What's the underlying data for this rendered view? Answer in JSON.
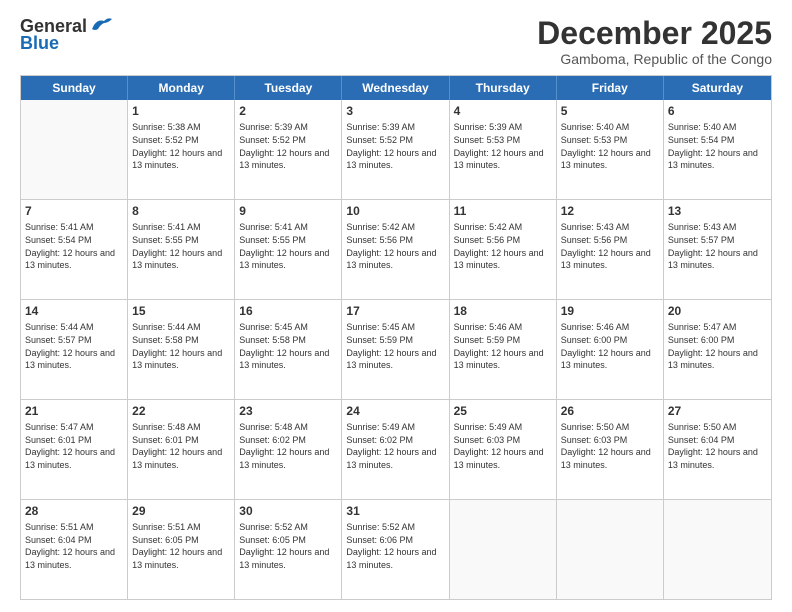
{
  "logo": {
    "general": "General",
    "blue": "Blue"
  },
  "title": "December 2025",
  "subtitle": "Gamboma, Republic of the Congo",
  "weekdays": [
    "Sunday",
    "Monday",
    "Tuesday",
    "Wednesday",
    "Thursday",
    "Friday",
    "Saturday"
  ],
  "weeks": [
    [
      {
        "day": "",
        "info": ""
      },
      {
        "day": "1",
        "info": "Sunrise: 5:38 AM\nSunset: 5:52 PM\nDaylight: 12 hours and 13 minutes."
      },
      {
        "day": "2",
        "info": "Sunrise: 5:39 AM\nSunset: 5:52 PM\nDaylight: 12 hours and 13 minutes."
      },
      {
        "day": "3",
        "info": "Sunrise: 5:39 AM\nSunset: 5:52 PM\nDaylight: 12 hours and 13 minutes."
      },
      {
        "day": "4",
        "info": "Sunrise: 5:39 AM\nSunset: 5:53 PM\nDaylight: 12 hours and 13 minutes."
      },
      {
        "day": "5",
        "info": "Sunrise: 5:40 AM\nSunset: 5:53 PM\nDaylight: 12 hours and 13 minutes."
      },
      {
        "day": "6",
        "info": "Sunrise: 5:40 AM\nSunset: 5:54 PM\nDaylight: 12 hours and 13 minutes."
      }
    ],
    [
      {
        "day": "7",
        "info": "Sunrise: 5:41 AM\nSunset: 5:54 PM\nDaylight: 12 hours and 13 minutes."
      },
      {
        "day": "8",
        "info": "Sunrise: 5:41 AM\nSunset: 5:55 PM\nDaylight: 12 hours and 13 minutes."
      },
      {
        "day": "9",
        "info": "Sunrise: 5:41 AM\nSunset: 5:55 PM\nDaylight: 12 hours and 13 minutes."
      },
      {
        "day": "10",
        "info": "Sunrise: 5:42 AM\nSunset: 5:56 PM\nDaylight: 12 hours and 13 minutes."
      },
      {
        "day": "11",
        "info": "Sunrise: 5:42 AM\nSunset: 5:56 PM\nDaylight: 12 hours and 13 minutes."
      },
      {
        "day": "12",
        "info": "Sunrise: 5:43 AM\nSunset: 5:56 PM\nDaylight: 12 hours and 13 minutes."
      },
      {
        "day": "13",
        "info": "Sunrise: 5:43 AM\nSunset: 5:57 PM\nDaylight: 12 hours and 13 minutes."
      }
    ],
    [
      {
        "day": "14",
        "info": "Sunrise: 5:44 AM\nSunset: 5:57 PM\nDaylight: 12 hours and 13 minutes."
      },
      {
        "day": "15",
        "info": "Sunrise: 5:44 AM\nSunset: 5:58 PM\nDaylight: 12 hours and 13 minutes."
      },
      {
        "day": "16",
        "info": "Sunrise: 5:45 AM\nSunset: 5:58 PM\nDaylight: 12 hours and 13 minutes."
      },
      {
        "day": "17",
        "info": "Sunrise: 5:45 AM\nSunset: 5:59 PM\nDaylight: 12 hours and 13 minutes."
      },
      {
        "day": "18",
        "info": "Sunrise: 5:46 AM\nSunset: 5:59 PM\nDaylight: 12 hours and 13 minutes."
      },
      {
        "day": "19",
        "info": "Sunrise: 5:46 AM\nSunset: 6:00 PM\nDaylight: 12 hours and 13 minutes."
      },
      {
        "day": "20",
        "info": "Sunrise: 5:47 AM\nSunset: 6:00 PM\nDaylight: 12 hours and 13 minutes."
      }
    ],
    [
      {
        "day": "21",
        "info": "Sunrise: 5:47 AM\nSunset: 6:01 PM\nDaylight: 12 hours and 13 minutes."
      },
      {
        "day": "22",
        "info": "Sunrise: 5:48 AM\nSunset: 6:01 PM\nDaylight: 12 hours and 13 minutes."
      },
      {
        "day": "23",
        "info": "Sunrise: 5:48 AM\nSunset: 6:02 PM\nDaylight: 12 hours and 13 minutes."
      },
      {
        "day": "24",
        "info": "Sunrise: 5:49 AM\nSunset: 6:02 PM\nDaylight: 12 hours and 13 minutes."
      },
      {
        "day": "25",
        "info": "Sunrise: 5:49 AM\nSunset: 6:03 PM\nDaylight: 12 hours and 13 minutes."
      },
      {
        "day": "26",
        "info": "Sunrise: 5:50 AM\nSunset: 6:03 PM\nDaylight: 12 hours and 13 minutes."
      },
      {
        "day": "27",
        "info": "Sunrise: 5:50 AM\nSunset: 6:04 PM\nDaylight: 12 hours and 13 minutes."
      }
    ],
    [
      {
        "day": "28",
        "info": "Sunrise: 5:51 AM\nSunset: 6:04 PM\nDaylight: 12 hours and 13 minutes."
      },
      {
        "day": "29",
        "info": "Sunrise: 5:51 AM\nSunset: 6:05 PM\nDaylight: 12 hours and 13 minutes."
      },
      {
        "day": "30",
        "info": "Sunrise: 5:52 AM\nSunset: 6:05 PM\nDaylight: 12 hours and 13 minutes."
      },
      {
        "day": "31",
        "info": "Sunrise: 5:52 AM\nSunset: 6:06 PM\nDaylight: 12 hours and 13 minutes."
      },
      {
        "day": "",
        "info": ""
      },
      {
        "day": "",
        "info": ""
      },
      {
        "day": "",
        "info": ""
      }
    ]
  ]
}
